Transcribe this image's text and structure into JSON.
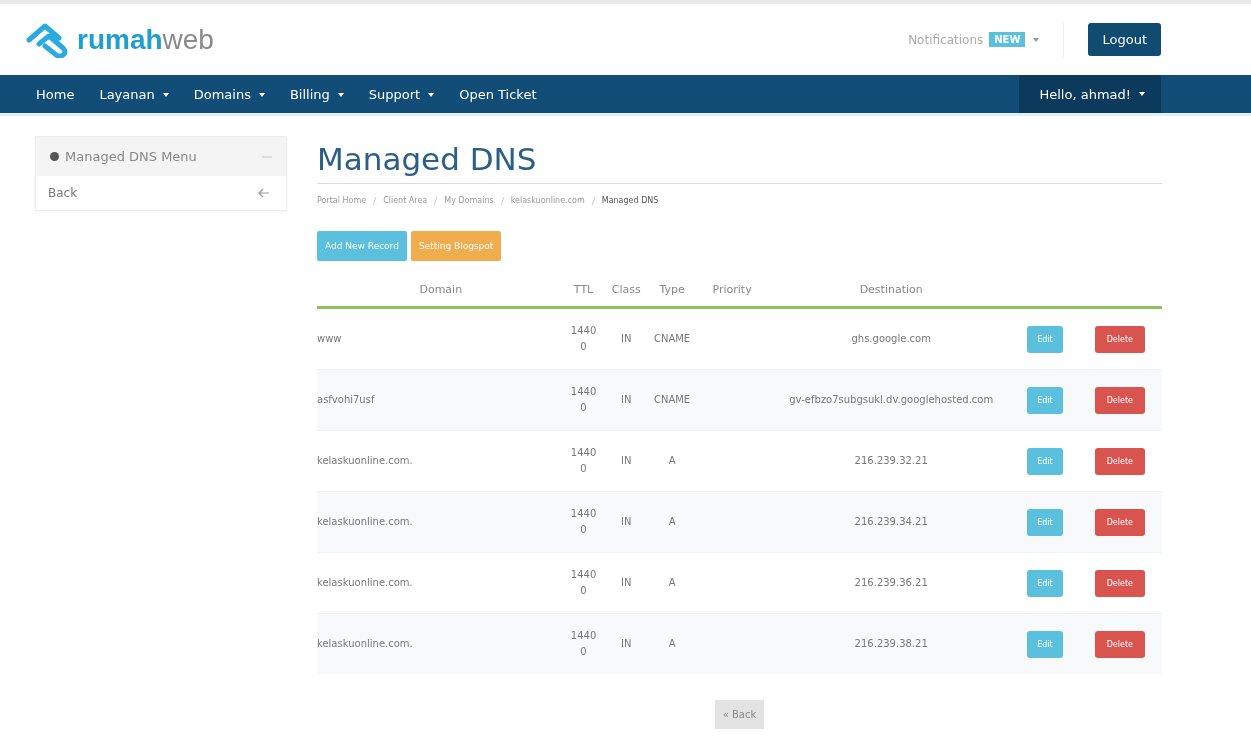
{
  "logo": {
    "primary": "rumah",
    "secondary": "web"
  },
  "header": {
    "notifications": "Notifications",
    "badge": "NEW",
    "logout": "Logout"
  },
  "nav": {
    "items": [
      {
        "label": "Home",
        "dropdown": false
      },
      {
        "label": "Layanan",
        "dropdown": true
      },
      {
        "label": "Domains",
        "dropdown": true
      },
      {
        "label": "Billing",
        "dropdown": true
      },
      {
        "label": "Support",
        "dropdown": true
      },
      {
        "label": "Open Ticket",
        "dropdown": false
      }
    ],
    "user": {
      "label": "Hello, ahmad!",
      "dropdown": true
    }
  },
  "sidebar": {
    "title": "Managed DNS Menu",
    "items": [
      {
        "label": "Back"
      }
    ]
  },
  "page": {
    "title": "Managed DNS",
    "breadcrumb": [
      {
        "label": "Portal Home",
        "current": false
      },
      {
        "label": "Client Area",
        "current": false
      },
      {
        "label": "My Domains",
        "current": false
      },
      {
        "label": "kelaskuonline.com",
        "current": false
      },
      {
        "label": "Managed DNS",
        "current": true
      }
    ],
    "buttons": [
      {
        "label": "Add New Record",
        "kind": "info"
      },
      {
        "label": "Setting Blogspot",
        "kind": "warning"
      }
    ]
  },
  "table": {
    "columns": [
      "Domain",
      "TTL",
      "Class",
      "Type",
      "Priority",
      "Destination"
    ],
    "rows": [
      {
        "domain": "www",
        "ttl": "14400",
        "class": "IN",
        "type": "CNAME",
        "destination": "ghs.google.com",
        "actions": [
          "Edit",
          "Delete"
        ]
      },
      {
        "domain": "asfvohi7usf",
        "ttl": "14400",
        "class": "IN",
        "type": "CNAME",
        "destination": "gv-efbzo7subgsukl.dv.googlehosted.com",
        "actions": [
          "Edit",
          "Delete"
        ]
      },
      {
        "domain": "kelaskuonline.com.",
        "ttl": "14400",
        "class": "IN",
        "type": "A",
        "destination": "216.239.32.21",
        "actions": [
          "Edit",
          "Delete"
        ]
      },
      {
        "domain": "kelaskuonline.com.",
        "ttl": "14400",
        "class": "IN",
        "type": "A",
        "destination": "216.239.34.21",
        "actions": [
          "Edit",
          "Delete"
        ]
      },
      {
        "domain": "kelaskuonline.com.",
        "ttl": "14400",
        "class": "IN",
        "type": "A",
        "destination": "216.239.36.21",
        "actions": [
          "Edit",
          "Delete"
        ]
      },
      {
        "domain": "kelaskuonline.com.",
        "ttl": "14400",
        "class": "IN",
        "type": "A",
        "destination": "216.239.38.21",
        "actions": [
          "Edit",
          "Delete"
        ]
      }
    ]
  },
  "back_button": "« Back"
}
